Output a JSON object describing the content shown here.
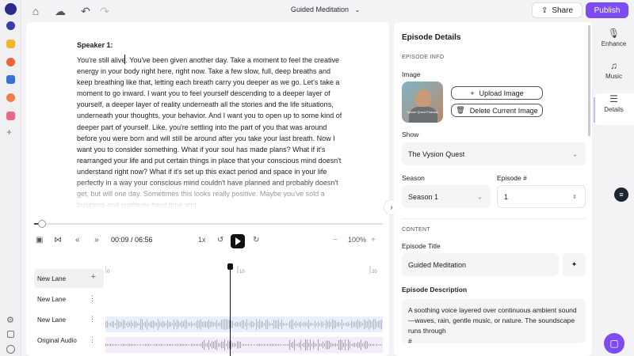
{
  "topbar": {
    "episode_title": "Guided Meditation",
    "share_label": "Share",
    "publish_label": "Publish",
    "accent": "#7c4cf0"
  },
  "editor": {
    "speaker": "Speaker 1:",
    "transcript": "You're still alive. You've been given another day. Take a moment to feel the creative energy in your body right here, right now. Take a few slow, full, deep breaths and keep breathing like that, letting each breath carry you deeper as we go. Let's take a moment to go inward. I want you to feel yourself descending to a deeper layer of yourself, a deeper layer of reality underneath all the stories and the life situations, underneath your thoughts, your behavior. And I want you to open up to some kind of deeper part of yourself. Like, you're settling into the part of you that was around before you were born and will still be around after you take your last breath. Now I want you to consider something. What if your soul has made plans? What if it's rearranged your life and put certain things in place that your conscious mind doesn't understand right now? What if it's set up this exact period and space in your life perfectly in a way your conscious mind couldn't have planned and probably doesn't get, but will one day. Sometimes this looks really positive. Maybe you've sold a business and suddenly have time and",
    "playback": {
      "time": "00:09 / 06:56",
      "speed": "1x",
      "zoom": "100%",
      "progress_fraction": 0.022
    },
    "ruler_ticks": [
      "0",
      "10",
      "20"
    ],
    "lanes": [
      {
        "label": "New Lane"
      },
      {
        "label": "New Lane"
      },
      {
        "label": "New Lane"
      },
      {
        "label": "Original Audio"
      }
    ]
  },
  "details": {
    "title": "Episode Details",
    "episode_info_caption": "EPISODE INFO",
    "image_label": "Image",
    "thumb_text": "Vysion Quest Podcast",
    "upload_label": "Upload Image",
    "delete_label": "Delete Current Image",
    "show_label": "Show",
    "show_value": "The Vysion Quest",
    "season_label": "Season",
    "season_value": "Season 1",
    "episode_num_label": "Episode #",
    "episode_num_value": "1",
    "content_caption": "CONTENT",
    "episode_title_label": "Episode Title",
    "episode_title_value": "Guided Meditation",
    "description_label": "Episode Description",
    "description_value": "A soothing voice layered over continuous ambient sound—waves, rain, gentle music, or nature. The soundscape runs through",
    "description_extra": "#"
  },
  "tools": {
    "enhance": "Enhance",
    "music": "Music",
    "details": "Details"
  }
}
